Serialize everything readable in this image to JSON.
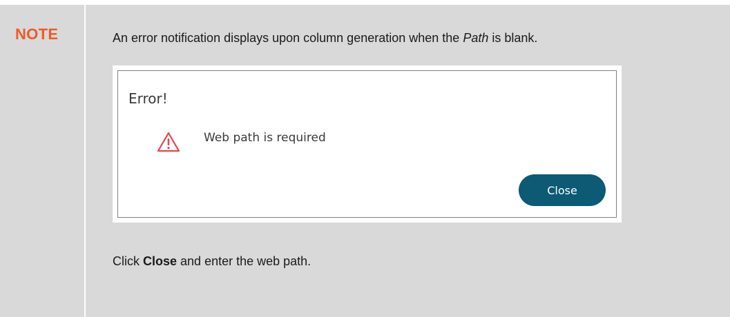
{
  "note": {
    "label": "NOTE",
    "label_color": "#f15a24",
    "intro_before": "An error notification displays upon column generation when the ",
    "intro_emphasis": "Path",
    "intro_after": " is blank.",
    "outro_before": "Click ",
    "outro_bold": "Close",
    "outro_after": " and enter the web path."
  },
  "dialog": {
    "title": "Error!",
    "icon": "warning-triangle-icon",
    "icon_color": "#e0474c",
    "message": "Web path is required",
    "close_label": "Close",
    "close_color": "#0c5a73"
  }
}
